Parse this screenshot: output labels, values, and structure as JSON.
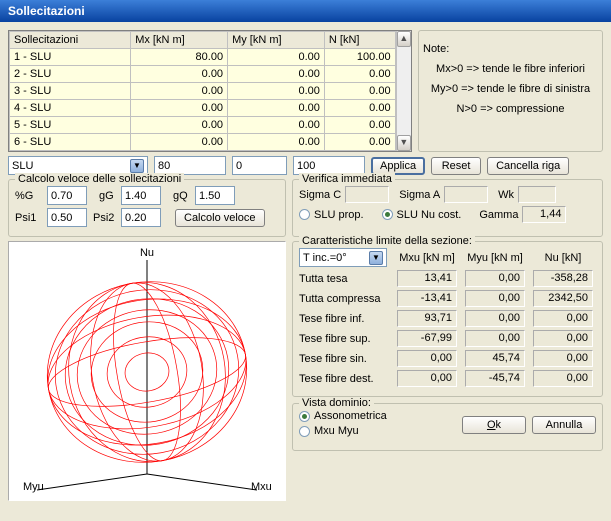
{
  "title": "Sollecitazioni",
  "table": {
    "headers": [
      "Sollecitazioni",
      "Mx [kN m]",
      "My [kN m]",
      "N [kN]"
    ],
    "rows": [
      {
        "label": "1 - SLU",
        "mx": "80.00",
        "my": "0.00",
        "n": "100.00"
      },
      {
        "label": "2 - SLU",
        "mx": "0.00",
        "my": "0.00",
        "n": "0.00"
      },
      {
        "label": "3 - SLU",
        "mx": "0.00",
        "my": "0.00",
        "n": "0.00"
      },
      {
        "label": "4 - SLU",
        "mx": "0.00",
        "my": "0.00",
        "n": "0.00"
      },
      {
        "label": "5 - SLU",
        "mx": "0.00",
        "my": "0.00",
        "n": "0.00"
      },
      {
        "label": "6 - SLU",
        "mx": "0.00",
        "my": "0.00",
        "n": "0.00"
      }
    ]
  },
  "notes": {
    "label": "Note:",
    "line1": "Mx>0 => tende le fibre inferiori",
    "line2": "My>0 => tende le fibre di sinistra",
    "line3": "N>0 => compressione"
  },
  "inputRow": {
    "combo": "SLU",
    "mx": "80",
    "my": "0",
    "n": "100",
    "apply": "Applica",
    "reset": "Reset",
    "delete": "Cancella riga"
  },
  "calc": {
    "title": "Calcolo veloce delle sollecitazioni",
    "pcG_lbl": "%G",
    "pcG": "0.70",
    "gG_lbl": "gG",
    "gG": "1.40",
    "gQ_lbl": "gQ",
    "gQ": "1.50",
    "psi1_lbl": "Psi1",
    "psi1": "0.50",
    "psi2_lbl": "Psi2",
    "psi2": "0.20",
    "btn": "Calcolo veloce"
  },
  "verify": {
    "title": "Verifica immediata",
    "sigmaC": "Sigma C",
    "sigmaA": "Sigma A",
    "wk": "Wk",
    "sluProp": "SLU prop.",
    "sluNu": "SLU Nu cost.",
    "gamma_lbl": "Gamma",
    "gamma": "1,44"
  },
  "limits": {
    "title": "Caratteristiche limite della sezione:",
    "combo": "T inc.=0°",
    "h_mxu": "Mxu [kN m]",
    "h_myu": "Myu [kN m]",
    "h_nu": "Nu [kN]",
    "rows": [
      {
        "label": "Tutta tesa",
        "mxu": "13,41",
        "myu": "0,00",
        "nu": "-358,28"
      },
      {
        "label": "Tutta compressa",
        "mxu": "-13,41",
        "myu": "0,00",
        "nu": "2342,50"
      },
      {
        "label": "Tese fibre inf.",
        "mxu": "93,71",
        "myu": "0,00",
        "nu": "0,00"
      },
      {
        "label": "Tese fibre sup.",
        "mxu": "-67,99",
        "myu": "0,00",
        "nu": "0,00"
      },
      {
        "label": "Tese fibre sin.",
        "mxu": "0,00",
        "myu": "45,74",
        "nu": "0,00"
      },
      {
        "label": "Tese fibre dest.",
        "mxu": "0,00",
        "myu": "-45,74",
        "nu": "0,00"
      }
    ]
  },
  "vista": {
    "title": "Vista dominio:",
    "asso": "Assonometrica",
    "mxumyu": "Mxu Myu",
    "ok": "Ok",
    "cancel": "Annulla"
  },
  "chart": {
    "nu": "Nu",
    "mxu": "Mxu",
    "myu": "Myu"
  }
}
